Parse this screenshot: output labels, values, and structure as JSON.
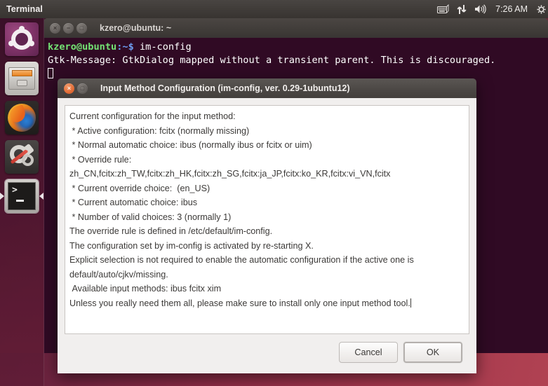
{
  "top_panel": {
    "app_title": "Terminal",
    "tray": {
      "keyboard_icon": "keyboard-icon",
      "network_icon": "network-updown-icon",
      "volume_icon": "volume-icon",
      "clock": "7:26 AM",
      "session_icon": "session-gear-icon"
    }
  },
  "launcher": {
    "items": [
      {
        "name": "ubuntu-dash",
        "label": "Ubuntu Dash",
        "icon": "ubuntu-logo-icon",
        "focused": false,
        "running": false
      },
      {
        "name": "files",
        "label": "Files",
        "icon": "file-cabinet-icon",
        "focused": false,
        "running": false
      },
      {
        "name": "firefox",
        "label": "Firefox Web Browser",
        "icon": "firefox-icon",
        "focused": false,
        "running": false
      },
      {
        "name": "settings",
        "label": "System Settings",
        "icon": "gear-wrench-icon",
        "focused": false,
        "running": false
      },
      {
        "name": "terminal",
        "label": "Terminal",
        "icon": "terminal-icon",
        "focused": true,
        "running": true
      }
    ]
  },
  "terminal_window": {
    "title": "kzero@ubuntu: ~",
    "buttons": {
      "close": "×",
      "minimize": "−",
      "maximize": "□"
    },
    "lines": [
      {
        "user": "kzero@ubuntu",
        "path": ":~$",
        "command": " im-config"
      },
      {
        "text": "Gtk-Message: GtkDialog mapped without a transient parent. This is discouraged."
      }
    ]
  },
  "dialog": {
    "title": "Input Method Configuration (im-config, ver. 0.29-1ubuntu12)",
    "buttons": {
      "close": "×",
      "maximize": "□"
    },
    "body_text": "Current configuration for the input method:\n * Active configuration: fcitx (normally missing)\n * Normal automatic choice: ibus (normally ibus or fcitx or uim)\n * Override rule:\nzh_CN,fcitx:zh_TW,fcitx:zh_HK,fcitx:zh_SG,fcitx:ja_JP,fcitx:ko_KR,fcitx:vi_VN,fcitx\n * Current override choice:  (en_US)\n * Current automatic choice: ibus\n * Number of valid choices: 3 (normally 1)\nThe override rule is defined in /etc/default/im-config.\nThe configuration set by im-config is activated by re-starting X.\nExplicit selection is not required to enable the automatic configuration if the active one is default/auto/cjkv/missing.\n Available input methods: ibus fcitx xim\nUnless you really need them all, please make sure to install only one input method tool.",
    "actions": {
      "cancel_label": "Cancel",
      "ok_label": "OK"
    }
  },
  "colors": {
    "terminal_bg": "#300a24",
    "panel_bg": "#403c39",
    "dialog_bg": "#f1efee",
    "accent_orange": "#e4703a",
    "prompt_green": "#74e374",
    "prompt_blue": "#6d9cf0"
  }
}
